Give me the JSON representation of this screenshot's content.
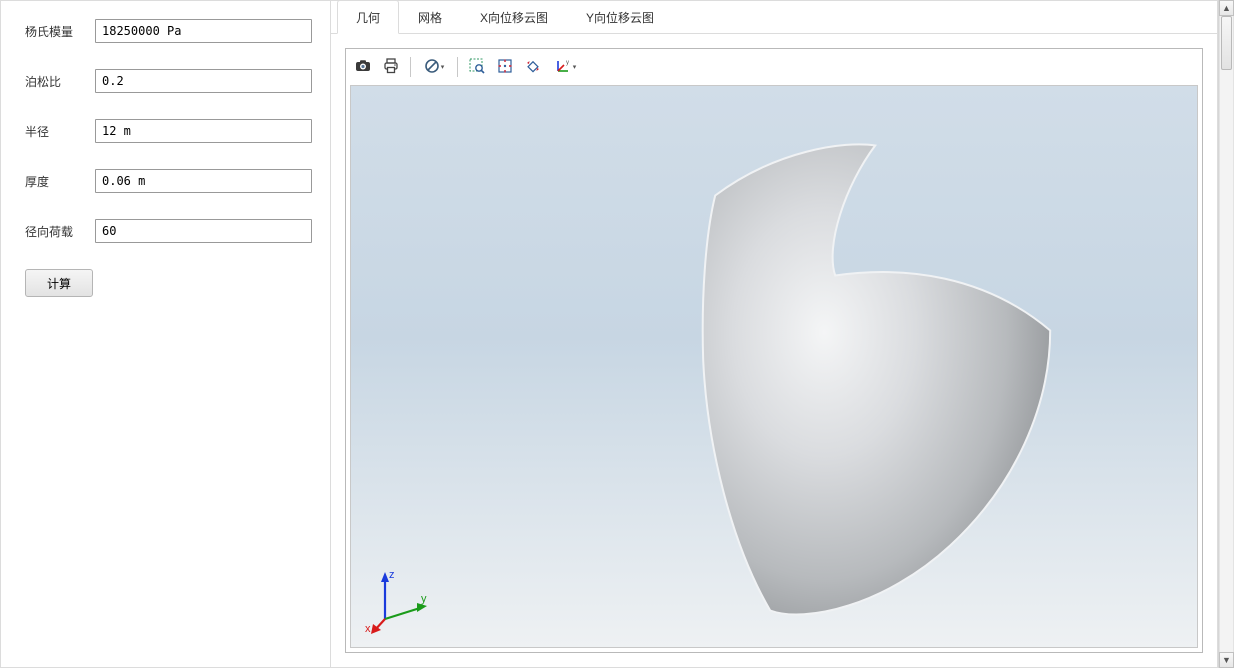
{
  "sidebar": {
    "params": [
      {
        "label": "杨氏模量",
        "value": "18250000 Pa"
      },
      {
        "label": "泊松比",
        "value": "0.2"
      },
      {
        "label": "半径",
        "value": "12 m"
      },
      {
        "label": "厚度",
        "value": "0.06 m"
      },
      {
        "label": "径向荷载",
        "value": "60"
      }
    ],
    "compute_label": "计算"
  },
  "tabs": {
    "items": [
      "几何",
      "网格",
      "X向位移云图",
      "Y向位移云图"
    ],
    "active_index": 0
  },
  "toolbar": {
    "icons": {
      "snapshot": "snapshot-icon",
      "print": "print-icon",
      "cancel": "no-symbol-icon",
      "zoom_window": "zoom-window-icon",
      "fit": "fit-view-icon",
      "rotate": "rotate-icon",
      "axes": "axes-triad-icon"
    }
  },
  "triad": {
    "x_label": "x",
    "y_label": "y",
    "z_label": "z",
    "x_color": "#d81b1b",
    "y_color": "#1a9b1a",
    "z_color": "#1a3bdc"
  }
}
